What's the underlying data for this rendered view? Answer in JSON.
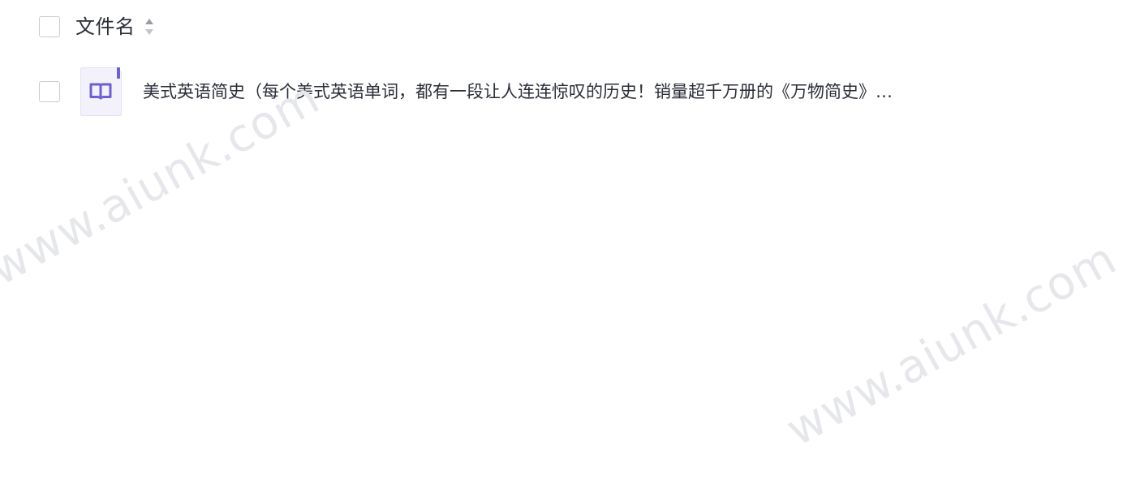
{
  "header": {
    "column_label": "文件名",
    "sort_icon": "sort-caret-icon"
  },
  "files": [
    {
      "name": "美式英语简史（每个美式英语单词，都有一段让人连连惊叹的历史！销量超千万册的《万物简史》…",
      "icon": "book-file-icon",
      "icon_color": "#6d5fd6"
    }
  ],
  "watermark": {
    "text": "www.aiunk.com"
  },
  "colors": {
    "text": "#2b2e38",
    "checkbox_border": "#c9ccd3",
    "icon_accent": "#6d5fd6",
    "watermark": "#e6e7eb"
  }
}
